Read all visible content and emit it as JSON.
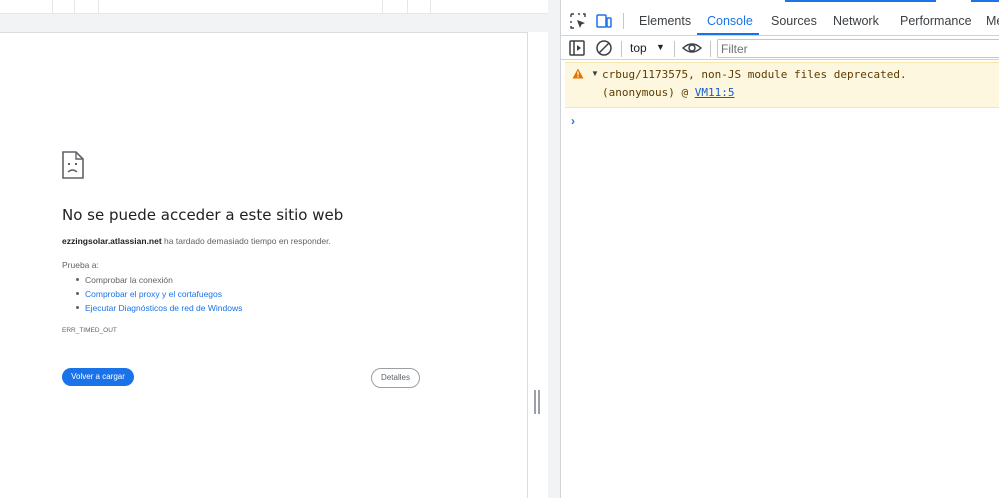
{
  "page": {
    "title": "No se puede acceder a este sitio web",
    "host": "ezzingsolar.atlassian.net",
    "desc_rest": " ha tardado demasiado tiempo en responder.",
    "try_label": "Prueba a:",
    "suggestions": [
      {
        "label": "Comprobar la conexión",
        "link": false
      },
      {
        "label": "Comprobar el proxy y el cortafuegos",
        "link": true
      },
      {
        "label": "Ejecutar Diagnósticos de red de Windows",
        "link": true
      }
    ],
    "error_code": "ERR_TIMED_OUT",
    "reload_label": "Volver a cargar",
    "details_label": "Detalles",
    "icon": "sad-page-icon"
  },
  "devtools": {
    "tabs": [
      {
        "label": "Elements",
        "active": false
      },
      {
        "label": "Console",
        "active": true
      },
      {
        "label": "Sources",
        "active": false
      },
      {
        "label": "Network",
        "active": false
      },
      {
        "label": "Performance",
        "active": false
      },
      {
        "label": "Me",
        "active": false
      }
    ],
    "context": "top",
    "filter_placeholder": "Filter",
    "warning": {
      "message": "crbug/1173575, non-JS module files deprecated.",
      "stack_prefix": "(anonymous) @ ",
      "stack_link": "VM11:5"
    },
    "prompt_symbol": "›",
    "icons": [
      "inspect-element-icon",
      "device-toolbar-icon",
      "sidebar-toggle-icon",
      "clear-console-icon",
      "eye-icon",
      "warning-icon"
    ]
  },
  "colors": {
    "accent": "#1a73e8",
    "warning_bg": "#fef7e0",
    "warning_icon": "#e37400"
  }
}
